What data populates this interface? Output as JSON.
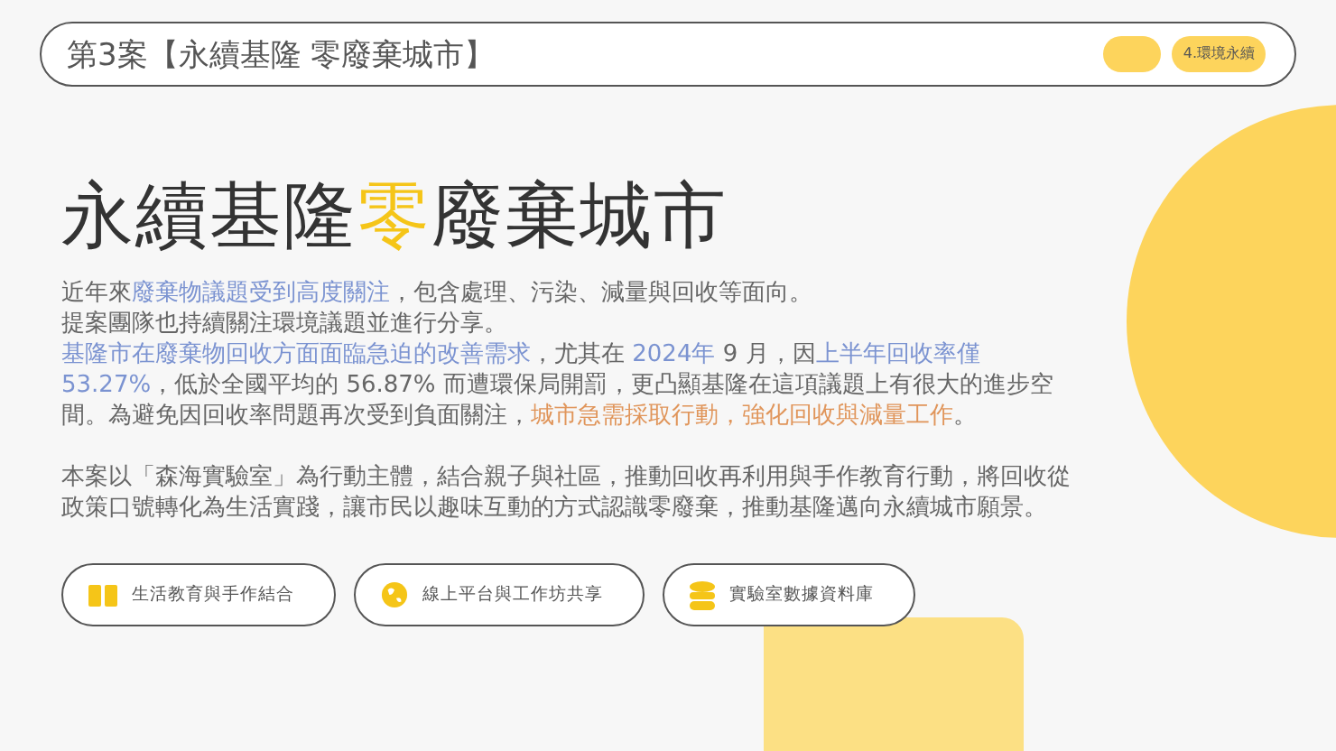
{
  "header": {
    "title": "第3案【永續基隆 零廢棄城市】",
    "tags": [
      {
        "label": "4.環境永續"
      }
    ]
  },
  "headline": [
    {
      "text": "永續基隆",
      "color": "#333333"
    },
    {
      "text": "零",
      "color": "#f5c518"
    },
    {
      "text": "廢棄城市",
      "color": "#333333"
    }
  ],
  "intro": [
    [
      {
        "text": "近年來",
        "color": "#666666"
      },
      {
        "text": "廢棄物議題受到高度關注",
        "color": "#7b93d1"
      },
      {
        "text": "，包含處理、污染、減量與回收等面向。",
        "color": "#666666"
      }
    ],
    [
      {
        "text": "提案團隊也持續關注環境議題並進行分享。",
        "color": "#666666"
      }
    ],
    [
      {
        "text": "基隆市在廢棄物回收方面面臨急迫的改善需求",
        "color": "#7b93d1"
      },
      {
        "text": "，尤其在 ",
        "color": "#666666"
      },
      {
        "text": "2024年",
        "color": "#7b93d1"
      },
      {
        "text": " 9 月，因",
        "color": "#666666"
      },
      {
        "text": "上半年回收率僅 53.27%",
        "color": "#7b93d1"
      },
      {
        "text": "，低於全國平均的 56.87% 而遭環保局開罰，更凸顯基隆在這項議題上有很大的進步空間。為避免因回收率問題再次受到負面關注，",
        "color": "#666666"
      },
      {
        "text": "城市急需採取行動，強化回收與減量工作",
        "color": "#e0955a"
      },
      {
        "text": "。",
        "color": "#666666"
      }
    ]
  ],
  "summary": "本案以「森海實驗室」為行動主體，結合親子與社區，推動回收再利用與手作教育行動，將回收從政策口號轉化為生活實踐，讓市民以趣味互動的方式認識零廢棄，推動基隆邁向永續城市願景。",
  "features": [
    {
      "kind": "book",
      "label": "生活教育與手作結合"
    },
    {
      "kind": "globe",
      "label": "線上平台與工作坊共享"
    },
    {
      "kind": "database",
      "label": "實驗室數據資料庫"
    }
  ]
}
